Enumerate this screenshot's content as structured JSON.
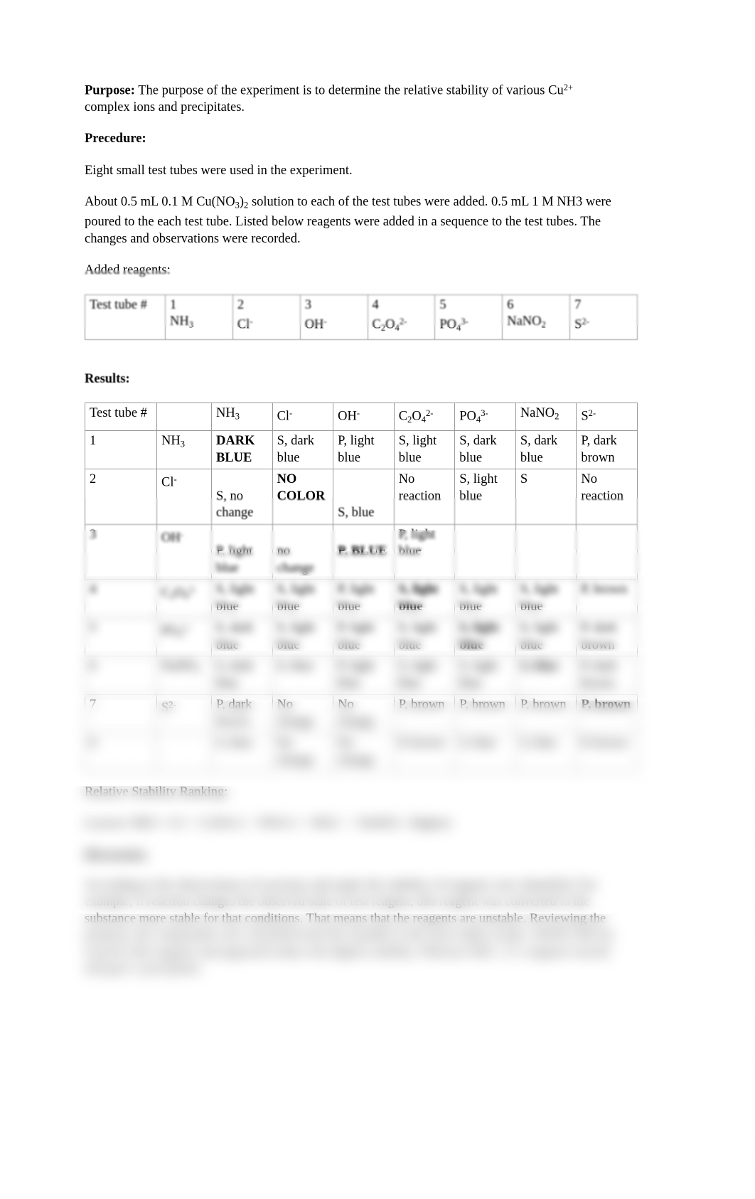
{
  "document": {
    "purpose_label": "Purpose:",
    "purpose_text_a": " The purpose of the experiment is to determine the relative stability of various Cu",
    "purpose_sup": "2+",
    "purpose_text_b": " complex ions and precipitates.",
    "procedure_heading": "Precedure:",
    "procedure_line1": "Eight small test tubes were used in the experiment.",
    "procedure_p2_a": "About 0.5 mL 0.1 M Cu(NO",
    "procedure_p2_sub1": "3",
    "procedure_p2_b": ")",
    "procedure_p2_sub2": "2",
    "procedure_p2_c": " solution to each of the test tubes were added. 0.5 mL 1 M NH3 were poured to the each test tube. Listed below reagents were added in a sequence to the test tubes.  The changes and observations were recorded.",
    "added_reagents_label": "Added reagents:",
    "results_heading": "Results:"
  },
  "reagent_table": {
    "row_label": "Test tube #",
    "numbers": [
      "1",
      "2",
      "3",
      "4",
      "5",
      "6",
      "7"
    ],
    "reagents": [
      {
        "base": "NH",
        "sub": "3",
        "sup": ""
      },
      {
        "base": "Cl",
        "sub": "",
        "sup": "-"
      },
      {
        "base": "OH",
        "sub": "",
        "sup": "-"
      },
      {
        "base": "C",
        "sub": "2",
        "base2": "O",
        "sub2": "4",
        "sup": "2-"
      },
      {
        "base": "PO",
        "sub": "4",
        "sup": "3-"
      },
      {
        "base": "NaNO",
        "sub": "2",
        "sup": ""
      },
      {
        "base": "S",
        "sub": "",
        "sup": "2-"
      }
    ]
  },
  "results_table": {
    "corner_label": "Test tube #",
    "columns": [
      {
        "base": "NH",
        "sub": "3",
        "sup": ""
      },
      {
        "base": "Cl",
        "sub": "",
        "sup": "-"
      },
      {
        "base": "OH",
        "sub": "",
        "sup": "-"
      },
      {
        "base": "C",
        "sub": "2",
        "base2": "O",
        "sub2": "4",
        "sup": "2-"
      },
      {
        "base": "PO",
        "sub": "4",
        "sup": "3-"
      },
      {
        "base": "NaNO",
        "sub": "2",
        "sup": ""
      },
      {
        "base": "S",
        "sub": "",
        "sup": "2-"
      }
    ],
    "rows": [
      {
        "num": "1",
        "reagent": {
          "base": "NH",
          "sub": "3",
          "sup": ""
        },
        "cells": [
          {
            "text": "DARK BLUE",
            "bold": true
          },
          {
            "text": "S, dark blue",
            "bold": false
          },
          {
            "text": "P, light blue",
            "bold": false
          },
          {
            "text": "S, light blue",
            "bold": false
          },
          {
            "text": "S, dark blue",
            "bold": false
          },
          {
            "text": "S, dark blue",
            "bold": false
          },
          {
            "text": "P, dark brown",
            "bold": false
          }
        ]
      },
      {
        "num": "2",
        "reagent": {
          "base": "Cl",
          "sub": "",
          "sup": "-"
        },
        "cells": [
          {
            "text": "S, no change",
            "bold": false,
            "pad": 1
          },
          {
            "text": "NO COLOR",
            "bold": true
          },
          {
            "text": "S, blue",
            "bold": false,
            "pad": 2
          },
          {
            "text": "No reaction",
            "bold": false
          },
          {
            "text": "S, light blue",
            "bold": false
          },
          {
            "text": "S",
            "bold": false
          },
          {
            "text": "No reaction",
            "bold": false
          }
        ]
      },
      {
        "num": "3",
        "reagent": {
          "base": "OH",
          "sub": "",
          "sup": "-"
        },
        "cells": [
          {
            "text": "P, light blue",
            "bold": false,
            "pad": 1
          },
          {
            "text": "no change",
            "bold": false,
            "pad": 1
          },
          {
            "text": "P, BLUE",
            "bold": true,
            "pad": 1
          },
          {
            "text": "P, light blue",
            "bold": false
          },
          {
            "text": "",
            "bold": false
          },
          {
            "text": "",
            "bold": false
          },
          {
            "text": "",
            "bold": false
          }
        ]
      },
      {
        "num": "4",
        "reagent": {
          "base": "C",
          "sub": "2",
          "base2": "O",
          "sub2": "4",
          "sup": "2-"
        },
        "cells": [
          {
            "text": "S, light blue",
            "bold": false
          },
          {
            "text": "S, light blue",
            "bold": false
          },
          {
            "text": "P, light blue",
            "bold": false
          },
          {
            "text": "S, light blue",
            "bold": true
          },
          {
            "text": "S, light blue",
            "bold": false
          },
          {
            "text": "S, light blue",
            "bold": false
          },
          {
            "text": "P, brown",
            "bold": false
          }
        ]
      },
      {
        "num": "5",
        "reagent": {
          "base": "PO",
          "sub": "4",
          "sup": "3-"
        },
        "cells": [
          {
            "text": "S, dark blue",
            "bold": false
          },
          {
            "text": "S, light blue",
            "bold": false
          },
          {
            "text": "P, light blue",
            "bold": false
          },
          {
            "text": "S, light blue",
            "bold": false
          },
          {
            "text": "S, light blue",
            "bold": true
          },
          {
            "text": "S, light blue",
            "bold": false
          },
          {
            "text": "P, dark brown",
            "bold": false
          }
        ]
      },
      {
        "num": "6",
        "reagent": {
          "base": "NaNO",
          "sub": "2",
          "sup": ""
        },
        "cells": [
          {
            "text": "S, dark blue",
            "bold": false
          },
          {
            "text": "S, blue",
            "bold": false
          },
          {
            "text": "P, light blue",
            "bold": false
          },
          {
            "text": "S, light blue",
            "bold": false
          },
          {
            "text": "S, light blue",
            "bold": false
          },
          {
            "text": "S, blue",
            "bold": true
          },
          {
            "text": "P, dark brown",
            "bold": false
          }
        ]
      },
      {
        "num": "7",
        "reagent": {
          "base": "S",
          "sub": "",
          "sup": "2-"
        },
        "cells": [
          {
            "text": "P, dark brown",
            "bold": false
          },
          {
            "text": "No change",
            "bold": false
          },
          {
            "text": "No change",
            "bold": false
          },
          {
            "text": "P, brown",
            "bold": false
          },
          {
            "text": "P, brown",
            "bold": false
          },
          {
            "text": "P, brown",
            "bold": false
          },
          {
            "text": "P, brown",
            "bold": true
          }
        ]
      },
      {
        "num": "8",
        "reagent": {
          "base": "",
          "sub": "",
          "sup": ""
        },
        "cells": [
          {
            "text": "S, blue",
            "bold": false
          },
          {
            "text": "No change",
            "bold": false
          },
          {
            "text": "No change",
            "bold": false
          },
          {
            "text": "P, brown",
            "bold": false
          },
          {
            "text": "S, blue",
            "bold": false
          },
          {
            "text": "S, blue",
            "bold": false
          },
          {
            "text": "P, brown",
            "bold": false
          }
        ]
      }
    ]
  },
  "lower": {
    "stability_heading": "Relative Stability Ranking:",
    "stability_text": "Lowest:  NH3 >  Cl-  > C2O4 2-  > PO4 3- >  NO2 - >  NaNO2 : Highest",
    "discussion_heading": "Discussion:",
    "discussion_text": "According to the observations of reactions and under the stability of reagents were identified. For example, if reaction changes the observed state of test reagent, this reagent was converted to the substance more stable for that conditions. That means that the reagents are unstable. Reviewing the property, the compounds were classified from the unstable to the most stable results. NaNO2 did not reacted with reagents and appeared reduce the highest stability. Whereas NH3 , Cl- reagents reacted and gave a precipitate."
  }
}
